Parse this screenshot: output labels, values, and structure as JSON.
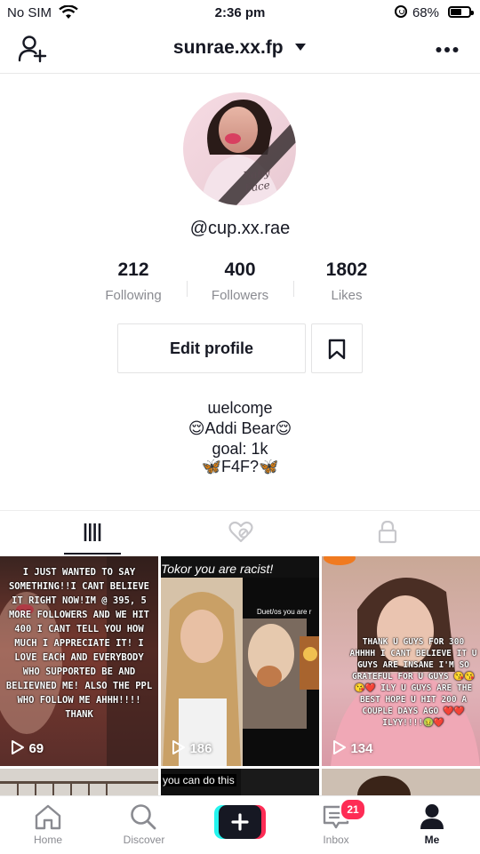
{
  "status_bar": {
    "carrier": "No SIM",
    "time": "2:36 pm",
    "battery": "68%",
    "battery_level": 0.68
  },
  "header": {
    "title": "sunrae.xx.fp"
  },
  "profile": {
    "username": "@cup.xx.rae",
    "stats": [
      {
        "value": "212",
        "label": "Following"
      },
      {
        "value": "400",
        "label": "Followers"
      },
      {
        "value": "1802",
        "label": "Likes"
      }
    ],
    "edit_label": "Edit profile",
    "bio": [
      "ɯelcoɱe",
      "😌Addi Bear😌",
      "goal: 1k",
      "🦋F4F?🦋"
    ]
  },
  "videos": [
    {
      "overlay": "I JUST WANTED TO SAY SOMETHING!!I CANT BELIEVE IT RIGHT NOW!IM @ 395, 5 MORE FOLLOWERS AND WE HIT 400 I CANT TELL YOU HOW MUCH I APPRECIATE IT! I LOVE EACH AND EVERYBODY WHO SUPPORTED BE AND BELIEVNED ME! ALSO THE PPL WHO FOLLOW ME AHHH!!!! THANK",
      "views": "69"
    },
    {
      "caption": "Tokor you are racist!",
      "duet": "Duet/os you are r",
      "views": "186"
    },
    {
      "overlay": "THANK U GUYS FOR 300 AHHHH I CANT BELIEVE IT U GUYS ARE INSANE I'M SO GRATEFUL FOR U GUYS 😘😘😘❤️ ILY U GUYS ARE THE BEST HOPE U HIT 200 A COUPLE DAYS AGO ❤️❤️ ILYY!!!!🤢❤️",
      "views": "134"
    },
    {
      "caption": ""
    },
    {
      "caption": "you can do this"
    },
    {
      "caption": ""
    }
  ],
  "nav": {
    "items": [
      {
        "label": "Home"
      },
      {
        "label": "Discover"
      },
      {
        "label": ""
      },
      {
        "label": "Inbox",
        "badge": "21"
      },
      {
        "label": "Me"
      }
    ]
  },
  "colors": {
    "accent": "#fe2c55",
    "cyan": "#25f4ee",
    "text": "#161823",
    "muted": "#8a8b91"
  }
}
